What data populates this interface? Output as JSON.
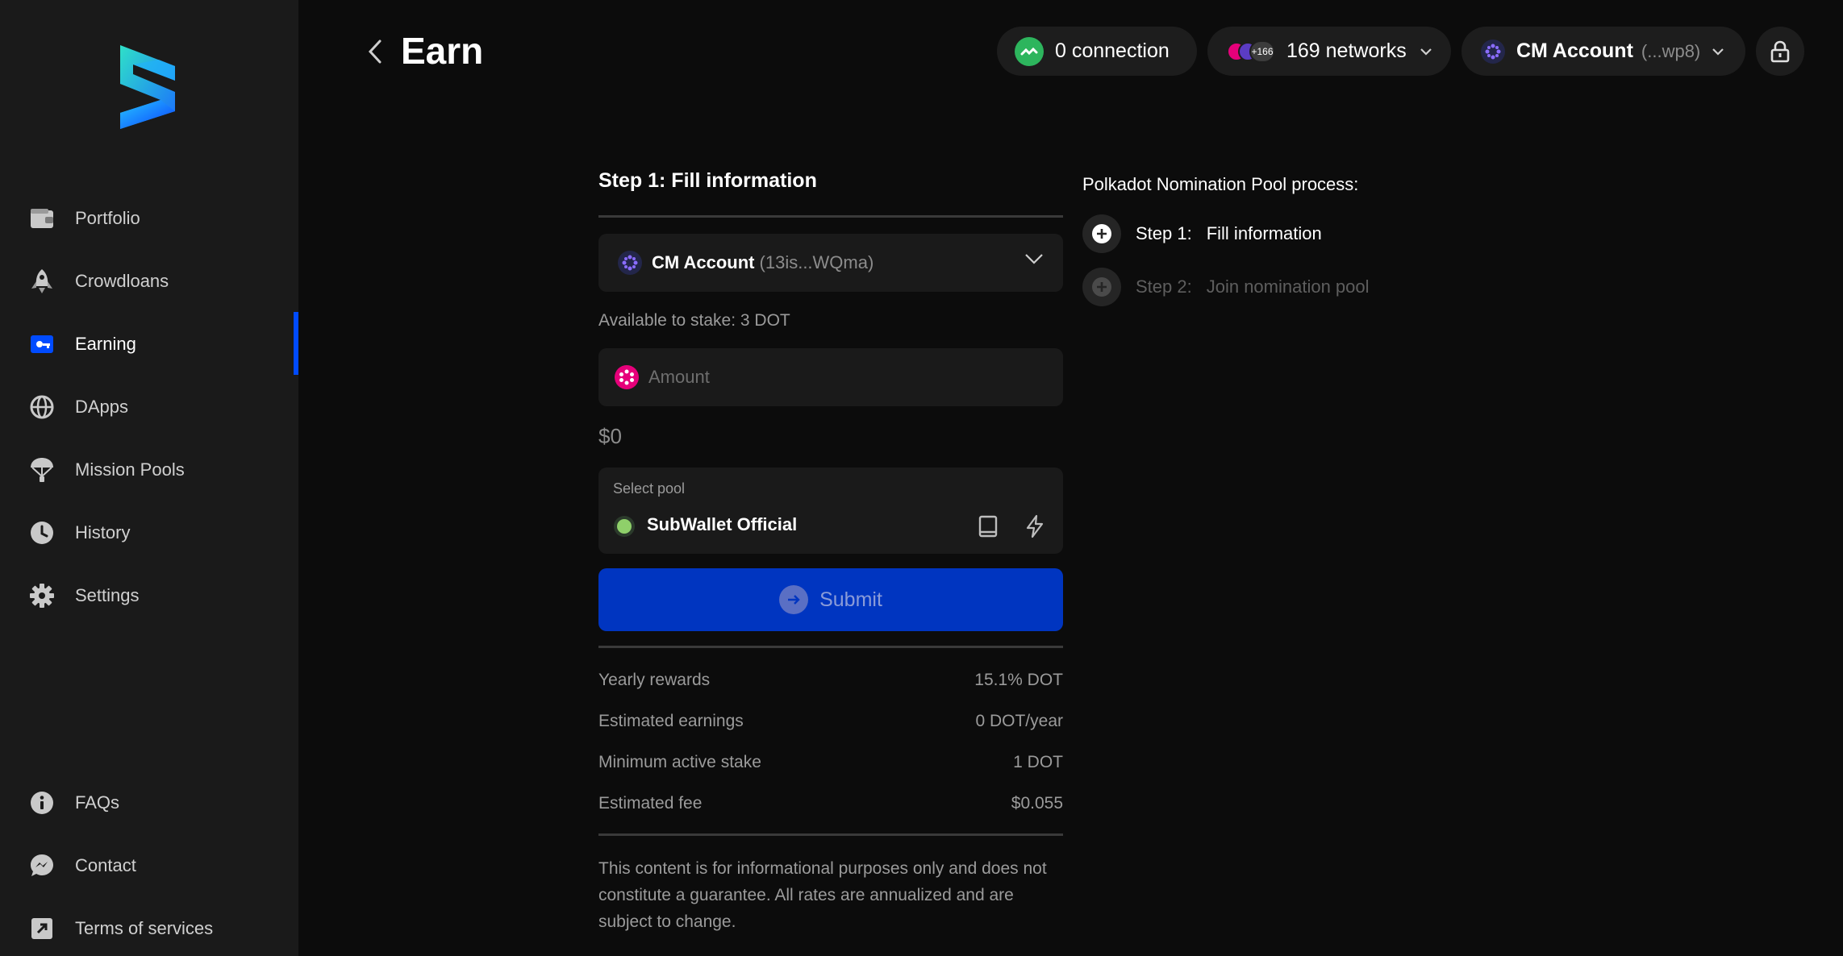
{
  "sidebar": {
    "items": [
      {
        "label": "Portfolio",
        "icon": "wallet-icon"
      },
      {
        "label": "Crowdloans",
        "icon": "rocket-icon"
      },
      {
        "label": "Earning",
        "icon": "earning-icon",
        "active": true
      },
      {
        "label": "DApps",
        "icon": "globe-icon"
      },
      {
        "label": "Mission Pools",
        "icon": "parachute-icon"
      },
      {
        "label": "History",
        "icon": "clock-icon"
      },
      {
        "label": "Settings",
        "icon": "gear-icon"
      }
    ],
    "bottom_items": [
      {
        "label": "FAQs",
        "icon": "info-icon"
      },
      {
        "label": "Contact",
        "icon": "chat-icon"
      },
      {
        "label": "Terms of services",
        "icon": "external-link-icon"
      }
    ]
  },
  "header": {
    "title": "Earn",
    "connection": "0 connection",
    "networks": "169 networks",
    "network_badge": "+166",
    "account_name": "CM Account",
    "account_short": "(...wp8)"
  },
  "form": {
    "step_title": "Step 1: Fill information",
    "account_name": "CM Account",
    "account_address": "(13is...WQma)",
    "available": "Available to stake: 3 DOT",
    "amount_placeholder": "Amount",
    "usd_value": "$0",
    "pool_label": "Select pool",
    "pool_name": "SubWallet Official",
    "submit_label": "Submit",
    "info": [
      {
        "label": "Yearly rewards",
        "value": "15.1% DOT"
      },
      {
        "label": "Estimated earnings",
        "value": "0 DOT/year"
      },
      {
        "label": "Minimum active stake",
        "value": "1 DOT"
      },
      {
        "label": "Estimated fee",
        "value": "$0.055"
      }
    ],
    "disclaimer": "This content is for informational purposes only and does not constitute a guarantee. All rates are annualized and are subject to change."
  },
  "process": {
    "title": "Polkadot Nomination Pool process:",
    "steps": [
      {
        "num": "Step 1:",
        "text": "Fill information",
        "state": "done"
      },
      {
        "num": "Step 2:",
        "text": "Join nomination pool",
        "state": "pending"
      }
    ]
  },
  "colors": {
    "accent": "#004bff",
    "submit": "#0035c0",
    "connection_green": "#2db55d",
    "polkadot_pink": "#e6007a"
  }
}
